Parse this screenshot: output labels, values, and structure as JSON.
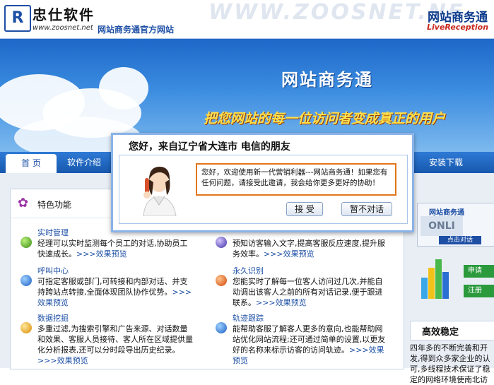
{
  "header": {
    "logo_mark": "R",
    "company_name": "忠仕软件",
    "url": "www.zoosnet.net",
    "tagline": "网站商务通官方网站",
    "watermark": "WWW.ZOOSNET.NE",
    "brand_cn": "网站商务通",
    "brand_en": "LiveReception"
  },
  "banner": {
    "title": "网站商务通",
    "slogan": "把您网站的每一位访问者变成真正的用户"
  },
  "nav": {
    "items": [
      "首 页",
      "软件介绍",
      "安装下载"
    ]
  },
  "features": {
    "heading": "特色功能",
    "more": ">>>效果预览",
    "items": [
      {
        "title": "实时管理",
        "desc": "经理可以实时监测每个员工的对话,协助员工快速成长。"
      },
      {
        "title": "呼叫中心",
        "desc": "可指定客服或部门,可转接和内部对话、并支持跨站点转接,全面体现团队协作优势。"
      },
      {
        "title": "数据挖掘",
        "desc": "多重过滤,为搜索引擎和广告来源、对话数量和效果、客服人员接待、客人所在区域提供量化分析报表,还可以分时段导出历史纪录。"
      },
      {
        "title": "",
        "desc": "预知访客输入文字,提高客服反应速度,提升服务效率。"
      },
      {
        "title": "永久识别",
        "desc": "您能实时了解每一位客人访问过几次,并能自动调出该客人之前的所有对话记录,便于跟进联系。"
      },
      {
        "title": "轨迹跟踪",
        "desc": "能帮助客服了解客人更多的意向,也能帮助网站优化网站流程;还可通过简单的设置,以更友好的名称来标示访客的访问轨迹。"
      }
    ]
  },
  "right": {
    "promo_title": "网站商务通",
    "promo_online": "ONLI",
    "promo_click": "点击对话",
    "btn1": "申请",
    "btn2": "注册",
    "stable_title": "高效稳定",
    "stable_desc": "四年多的不断完善和开发,得到众多家企业的认可,多线程技术保证了稳定的网络环境使南北访"
  },
  "dialog": {
    "title": "您好，来自辽宁省大连市  电信的朋友",
    "message": "您好，欢迎使用新一代营销利器---网站商务通！如果您有任何问题，请接受此邀请，我会给你更多更好的协助！",
    "accept": "接 受",
    "decline": "暂不对话"
  },
  "colors": {
    "accent": "#1d4fa5",
    "highlight": "#e2761b",
    "slogan": "#ffe04a"
  }
}
